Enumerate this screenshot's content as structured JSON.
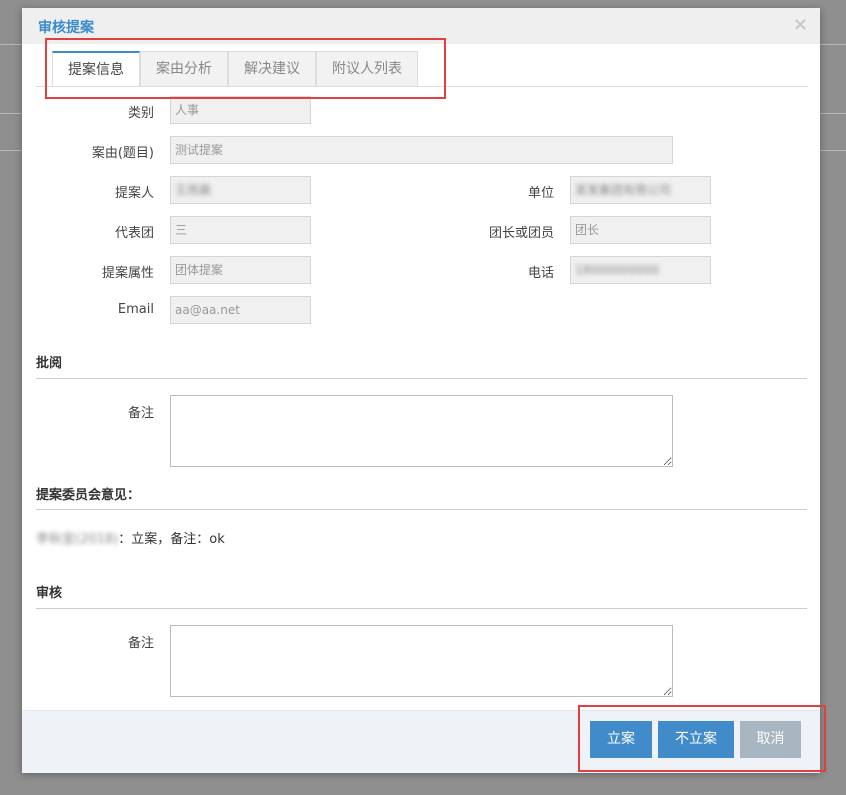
{
  "dialog": {
    "title": "审核提案",
    "close_glyph": "×"
  },
  "tabs": [
    {
      "label": "提案信息",
      "active": true
    },
    {
      "label": "案由分析",
      "active": false
    },
    {
      "label": "解决建议",
      "active": false
    },
    {
      "label": "附议人列表",
      "active": false
    }
  ],
  "form": {
    "category": {
      "label": "类别",
      "value": "人事"
    },
    "subject": {
      "label": "案由(题目)",
      "value": "测试提案"
    },
    "proposer": {
      "label": "提案人",
      "value": "王雨晨"
    },
    "unit": {
      "label": "单位",
      "value": "某某集团有限公司"
    },
    "delegation": {
      "label": "代表团",
      "value": "三"
    },
    "role": {
      "label": "团长或团员",
      "value": "团长"
    },
    "attribute": {
      "label": "提案属性",
      "value": "团体提案"
    },
    "phone": {
      "label": "电话",
      "value": "18000000000"
    },
    "email": {
      "label": "Email",
      "value": "aa@aa.net"
    }
  },
  "review_section": {
    "title": "批阅",
    "remark_label": "备注",
    "remark_value": ""
  },
  "committee_section": {
    "title": "提案委员会意见：",
    "opinion_blurred": "李秋宜(2018)",
    "opinion_text": "：立案，备注：ok"
  },
  "audit_section": {
    "title": "审核",
    "remark_label": "备注",
    "remark_value": ""
  },
  "buttons": {
    "approve": "立案",
    "reject": "不立案",
    "cancel": "取消"
  },
  "colors": {
    "accent": "#3a8bcd",
    "button_primary": "#428bca",
    "button_disabled": "#a7b6c0",
    "highlight_box": "#e04040"
  }
}
